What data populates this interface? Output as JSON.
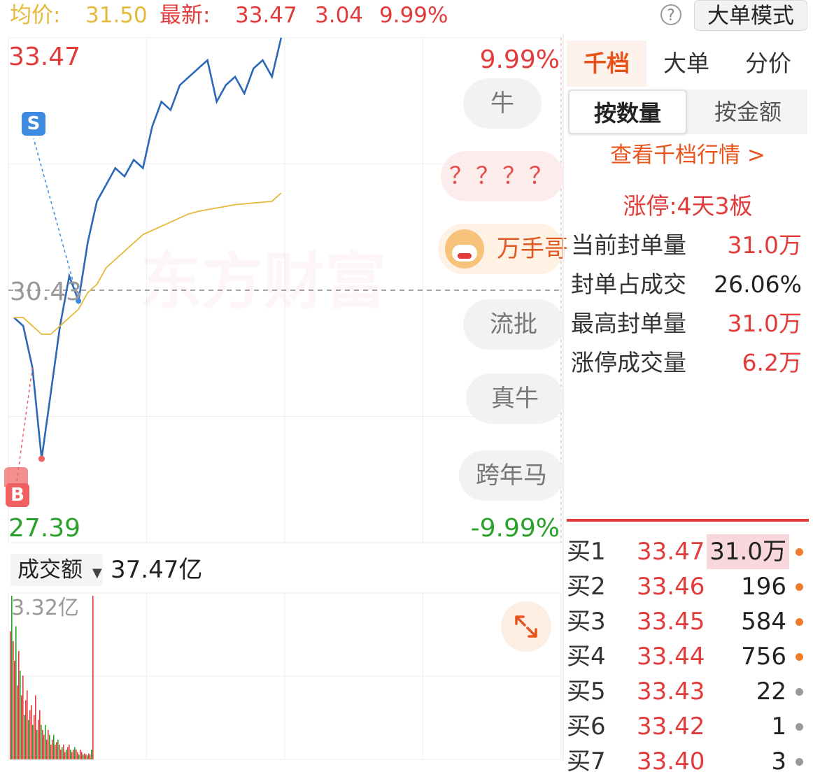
{
  "header": {
    "avg_label": "均价:",
    "avg_value": "31.50",
    "latest_label": "最新:",
    "latest_value": "33.47",
    "change": "3.04",
    "change_pct": "9.99%",
    "help_glyph": "?",
    "big_order_mode": "大单模式"
  },
  "chart": {
    "price_high": "33.47",
    "pct_high": "9.99%",
    "price_prev_close": "30.43",
    "price_low": "27.39",
    "pct_low": "-9.99%",
    "watermark": "东方财富",
    "sell_marker": "S",
    "buy_marker": "B",
    "tags": [
      {
        "label": "牛"
      },
      {
        "label": "？？？？"
      },
      {
        "label": "万手哥"
      },
      {
        "label": "流批"
      },
      {
        "label": "真牛"
      },
      {
        "label": "跨年马"
      }
    ]
  },
  "volume": {
    "selector_label": "成交额",
    "total": "37.47亿",
    "max_label": "3.32亿"
  },
  "chart_data": {
    "type": "line",
    "prev_close": 30.43,
    "ylim": [
      27.39,
      33.47
    ],
    "series": [
      {
        "values": [
          30.1,
          30.0,
          29.5,
          28.4,
          29.2,
          30.0,
          30.6,
          30.3,
          31.0,
          31.5,
          31.7,
          31.9,
          31.8,
          32.0,
          31.9,
          32.4,
          32.7,
          32.6,
          32.9,
          33.0,
          33.1,
          33.2,
          32.7,
          32.9,
          33.0,
          32.8,
          33.1,
          33.2,
          33.0,
          33.47
        ]
      },
      {
        "values": [
          30.1,
          30.1,
          30.0,
          29.9,
          29.9,
          30.0,
          30.1,
          30.2,
          30.4,
          30.5,
          30.7,
          30.8,
          30.9,
          31.0,
          31.1,
          31.15,
          31.2,
          31.25,
          31.3,
          31.35,
          31.38,
          31.4,
          31.42,
          31.44,
          31.46,
          31.47,
          31.48,
          31.49,
          31.5,
          31.6
        ]
      }
    ],
    "volume": [
      2.6,
      3.32,
      2.4,
      2.0,
      2.7,
      1.5,
      2.2,
      1.8,
      1.3,
      1.7,
      0.9,
      1.2,
      1.4,
      0.8,
      1.0,
      1.1,
      0.7,
      0.9,
      1.3,
      0.6,
      0.8,
      1.0,
      0.7,
      0.6,
      0.5,
      0.7,
      0.4,
      0.6,
      0.5,
      0.3,
      0.4,
      0.5,
      0.3,
      0.35,
      0.4,
      0.3,
      0.2,
      0.25,
      0.3,
      0.15,
      0.2,
      0.25,
      0.3,
      0.2,
      0.15,
      0.2,
      0.25,
      0.2,
      0.15,
      0.1,
      0.2,
      0.15,
      0.1,
      0.12,
      0.1,
      0.08,
      0.12,
      0.1,
      0.2,
      3.32
    ],
    "volume_unit": "亿",
    "colors": {
      "price": "#2c68b8",
      "avg": "#e6b93c",
      "up": "#e23b3b",
      "down": "#2aa12a"
    }
  },
  "panel": {
    "tabs": [
      {
        "label": "千档",
        "active": true
      },
      {
        "label": "大单",
        "active": false
      },
      {
        "label": "分价",
        "active": false
      }
    ],
    "segments": [
      {
        "label": "按数量",
        "active": true
      },
      {
        "label": "按金额",
        "active": false
      }
    ],
    "view_link": "查看千档行情 >",
    "limit_up": "涨停:4天3板",
    "stats": [
      {
        "label": "当前封单量",
        "value": "31.0万",
        "color": "#e23b3b"
      },
      {
        "label": "封单占成交",
        "value": "26.06%",
        "color": "#222222"
      },
      {
        "label": "最高封单量",
        "value": "31.0万",
        "color": "#e23b3b"
      },
      {
        "label": "涨停成交量",
        "value": "6.2万",
        "color": "#e23b3b"
      }
    ]
  },
  "order_book": [
    {
      "name": "买1",
      "price": "33.47",
      "qty": "31.0万",
      "highlight": true,
      "dot": "#f07b2a"
    },
    {
      "name": "买2",
      "price": "33.46",
      "qty": "196",
      "highlight": false,
      "dot": "#f07b2a"
    },
    {
      "name": "买3",
      "price": "33.45",
      "qty": "584",
      "highlight": false,
      "dot": "#f07b2a"
    },
    {
      "name": "买4",
      "price": "33.44",
      "qty": "756",
      "highlight": false,
      "dot": "#f07b2a"
    },
    {
      "name": "买5",
      "price": "33.43",
      "qty": "22",
      "highlight": false,
      "dot": "#999999"
    },
    {
      "name": "买6",
      "price": "33.42",
      "qty": "1",
      "highlight": false,
      "dot": "#999999"
    },
    {
      "name": "买7",
      "price": "33.40",
      "qty": "3",
      "highlight": false,
      "dot": "#999999"
    }
  ]
}
